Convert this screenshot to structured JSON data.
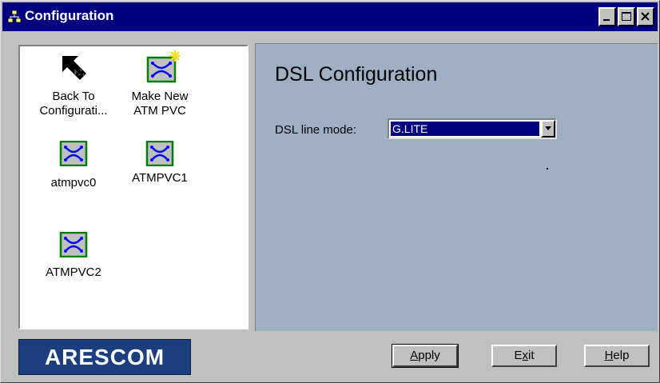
{
  "window": {
    "title": "Configuration",
    "controls": {
      "minimize": "minimize-icon",
      "maximize": "maximize-icon",
      "close": "close-icon"
    }
  },
  "left_panel": {
    "items": [
      {
        "label_line1": "Back To",
        "label_line2": "Configurati...",
        "icon": "back-arrow-icon"
      },
      {
        "label_line1": "Make New",
        "label_line2": "ATM PVC",
        "icon": "new-pvc-icon"
      },
      {
        "label_line1": "atmpvc0",
        "icon": "pvc-icon"
      },
      {
        "label_line1": "ATMPVC1",
        "icon": "pvc-icon"
      },
      {
        "label_line1": "ATMPVC2",
        "icon": "pvc-icon"
      }
    ]
  },
  "right_panel": {
    "heading": "DSL Configuration",
    "mode_label": "DSL line mode:",
    "mode_value": "G.LITE"
  },
  "footer": {
    "logo": "ARESCOM",
    "apply": {
      "mnemonic": "A",
      "rest": "pply"
    },
    "exit": {
      "pre": "E",
      "mnemonic": "x",
      "rest": "it"
    },
    "help": {
      "mnemonic": "H",
      "rest": "elp"
    }
  },
  "colors": {
    "titlebar": "#000080",
    "panel_bg": "#a0b0c4",
    "logo_bg": "#1c3e7e"
  }
}
